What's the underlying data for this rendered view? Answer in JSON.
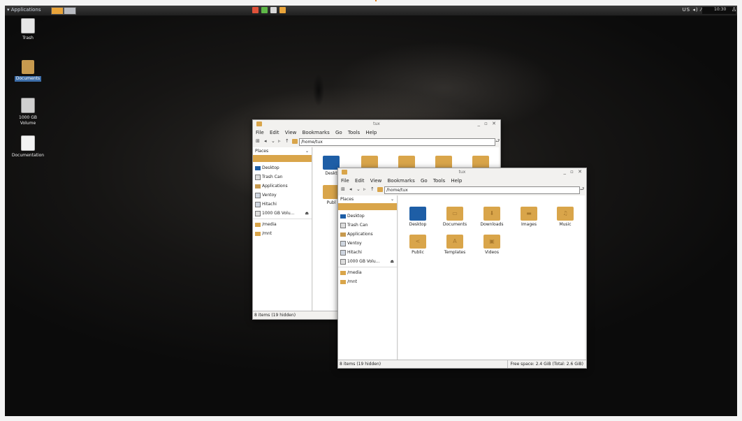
{
  "panel": {
    "apps_label": "Applications",
    "tray_text": "US ◂) ⁄",
    "clock": "10:30"
  },
  "desktop_icons": [
    {
      "label": "Trash"
    },
    {
      "label": "Documents"
    },
    {
      "label": "1000 GB Volume"
    },
    {
      "label": "Documentation"
    }
  ],
  "back_window": {
    "title": "tux",
    "menu": [
      "File",
      "Edit",
      "View",
      "Bookmarks",
      "Go",
      "Tools",
      "Help"
    ],
    "path": "/home/tux",
    "places_label": "Places",
    "sidebar_items": [
      "Desktop",
      "Trash Can",
      "Applications",
      "Ventoy",
      "Hitachi",
      "1000 GB Volu...",
      "/media",
      "/mnt"
    ],
    "visible_files": [
      "Deskt",
      "Publ"
    ],
    "status": "8 items (19 hidden)"
  },
  "front_window": {
    "title": "tux",
    "menu": [
      "File",
      "Edit",
      "View",
      "Bookmarks",
      "Go",
      "Tools",
      "Help"
    ],
    "path": "/home/tux",
    "places_label": "Places",
    "sidebar_items": [
      "Desktop",
      "Trash Can",
      "Applications",
      "Ventoy",
      "Hitachi",
      "1000 GB Volu...",
      "/media",
      "/mnt"
    ],
    "files": [
      "Desktop",
      "Documents",
      "Downloads",
      "Images",
      "Music",
      "Public",
      "Templates",
      "Videos"
    ],
    "status_left": "8 items (19 hidden)",
    "status_right": "Free space: 2.4 GiB (Total: 2.6 GiB)"
  },
  "colors": {
    "folder": "#d9a54a",
    "selection": "#3d6ea9",
    "desktop_folder": "#1e5ea6"
  }
}
